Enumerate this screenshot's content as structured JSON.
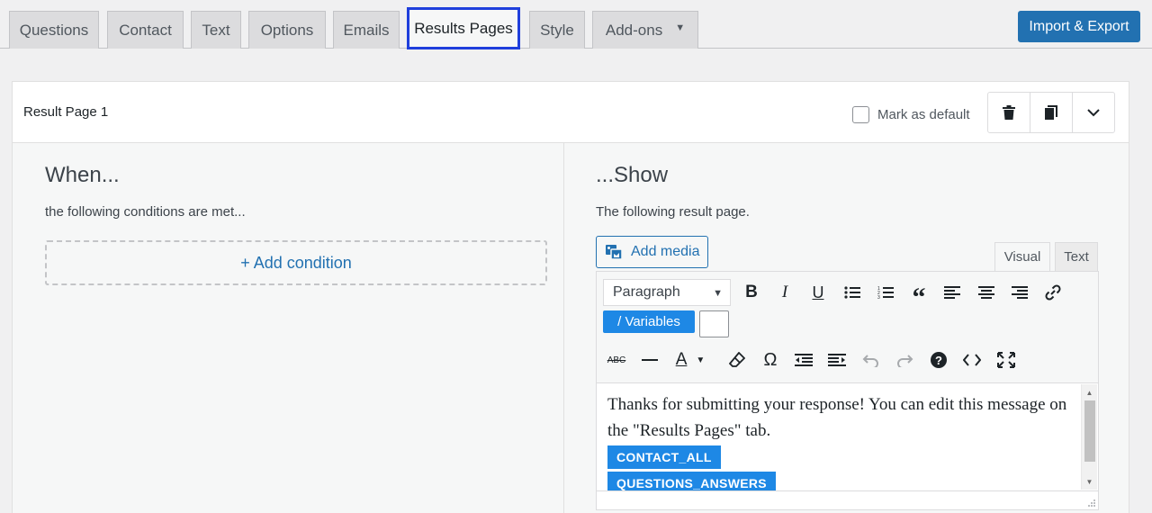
{
  "tabs": [
    {
      "label": "Questions"
    },
    {
      "label": "Contact"
    },
    {
      "label": "Text"
    },
    {
      "label": "Options"
    },
    {
      "label": "Emails"
    },
    {
      "label": "Results Pages",
      "active": true
    },
    {
      "label": "Style"
    },
    {
      "label": "Add-ons",
      "has_caret": true
    }
  ],
  "import_export_label": "Import & Export",
  "result_page": {
    "title": "Result Page 1",
    "default_label": "Mark as default",
    "default_checked": false
  },
  "when": {
    "heading": "When...",
    "subtitle": "the following conditions are met...",
    "add_condition": "+ Add condition"
  },
  "show": {
    "heading": "...Show",
    "subtitle": "The following result page.",
    "add_media": "Add media",
    "mode_visual": "Visual",
    "mode_text": "Text"
  },
  "editor": {
    "format": "Paragraph",
    "variables_label": "/ Variables",
    "text_color_letter": "A",
    "content_text": "Thanks for submitting your response! You can edit this message on the \"Results Pages\" tab.",
    "tags": [
      "CONTACT_ALL",
      "QUESTIONS_ANSWERS"
    ]
  },
  "colors": {
    "accent": "#2271b1",
    "active_tab_outline": "#1f3fdc",
    "variable_tag": "#1e88e5"
  }
}
